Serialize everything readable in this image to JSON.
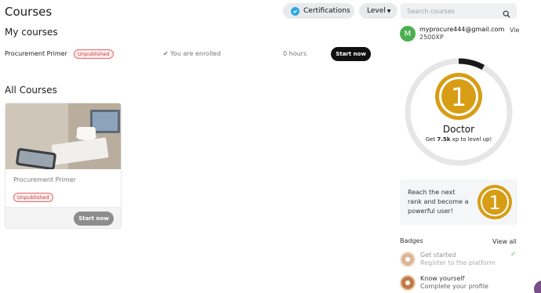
{
  "page": {
    "title": "Courses"
  },
  "topbar": {
    "certifications_label": "Certifications",
    "level_label": "Level",
    "search_placeholder": "Search courses"
  },
  "my_courses": {
    "title": "My courses",
    "items": [
      {
        "name": "Procurement Primer",
        "status_tag": "Unpublished",
        "enrolled_text": "You are enrolled",
        "hours": "0 hours",
        "action": "Start now"
      }
    ]
  },
  "all_courses": {
    "title": "All Courses",
    "cards": [
      {
        "name": "Procurement Primer",
        "status_tag": "Unpublished",
        "action": "Start now"
      }
    ]
  },
  "profile": {
    "avatar_letter": "M",
    "email": "myprocure444@gmail.com",
    "xp": "2500XP",
    "view_label": "Vie",
    "rank_number": "1",
    "rank_name": "Doctor",
    "next_level_prefix": "Get ",
    "next_level_xp": "7.5k",
    "next_level_suffix": " xp to level up!",
    "progress_fraction": 0.08
  },
  "reach": {
    "text": "Reach the next rank and become a powerful user!",
    "medal_number": "1"
  },
  "badges": {
    "title": "Badges",
    "view_all": "View all",
    "items": [
      {
        "title": "Get started",
        "subtitle": "Register to the platform"
      },
      {
        "title": "Know yourself",
        "subtitle": "Complete your profile"
      }
    ]
  },
  "colors": {
    "accent_gold": "#d79d14",
    "ring_grey": "#e6e6e6",
    "tag_red": "#c94444",
    "avatar_green": "#4caf50"
  }
}
